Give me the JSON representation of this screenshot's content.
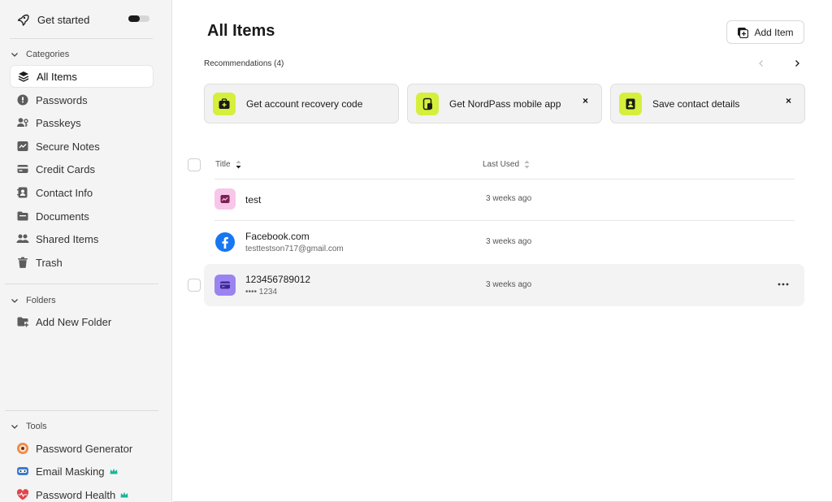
{
  "sidebar": {
    "get_started": {
      "label": "Get started",
      "icon": "rocket-icon"
    },
    "categories": {
      "header": "Categories",
      "items": [
        {
          "label": "All Items",
          "icon": "layers-icon",
          "active": true
        },
        {
          "label": "Passwords",
          "icon": "password-icon"
        },
        {
          "label": "Passkeys",
          "icon": "passkey-icon"
        },
        {
          "label": "Secure Notes",
          "icon": "note-icon"
        },
        {
          "label": "Credit Cards",
          "icon": "credit-card-icon"
        },
        {
          "label": "Contact Info",
          "icon": "contact-icon"
        },
        {
          "label": "Documents",
          "icon": "folder-icon"
        },
        {
          "label": "Shared Items",
          "icon": "shared-users-icon"
        },
        {
          "label": "Trash",
          "icon": "trash-icon"
        }
      ]
    },
    "folders": {
      "header": "Folders",
      "items": [
        {
          "label": "Add New Folder",
          "icon": "add-folder-icon"
        }
      ]
    },
    "tools": {
      "header": "Tools",
      "items": [
        {
          "label": "Password Generator",
          "icon": "password-generator-icon"
        },
        {
          "label": "Email Masking",
          "icon": "email-masking-icon",
          "premium": true
        },
        {
          "label": "Password Health",
          "icon": "heart-pulse-icon",
          "premium": true
        }
      ]
    }
  },
  "main": {
    "title": "All Items",
    "add_button": "Add Item",
    "recommendations": {
      "label": "Recommendations (4)",
      "cards": [
        {
          "label": "Get account recovery code",
          "icon": "briefcase-plus-icon",
          "closable": false
        },
        {
          "label": "Get NordPass mobile app",
          "icon": "mobile-icon",
          "closable": true,
          "close": "×"
        },
        {
          "label": "Save contact details",
          "icon": "contact-book-icon",
          "closable": true,
          "close": "×"
        }
      ]
    },
    "table": {
      "columns": {
        "title": "Title",
        "last_used": "Last Used"
      },
      "rows": [
        {
          "name": "test",
          "sub": "",
          "last_used": "3 weeks ago",
          "icon": "secure-note-icon"
        },
        {
          "name": "Facebook.com",
          "sub": "testtestson717@gmail.com",
          "last_used": "3 weeks ago",
          "icon": "facebook-icon"
        },
        {
          "name": "123456789012",
          "sub": "•••• 1234",
          "last_used": "3 weeks ago",
          "icon": "credit-card-icon"
        }
      ]
    }
  },
  "colors": {
    "accent": "#d6ef3c",
    "note_icon_bg": "#f7c6e8",
    "card_icon_bg": "#9b84f0",
    "facebook": "#1877f2"
  }
}
